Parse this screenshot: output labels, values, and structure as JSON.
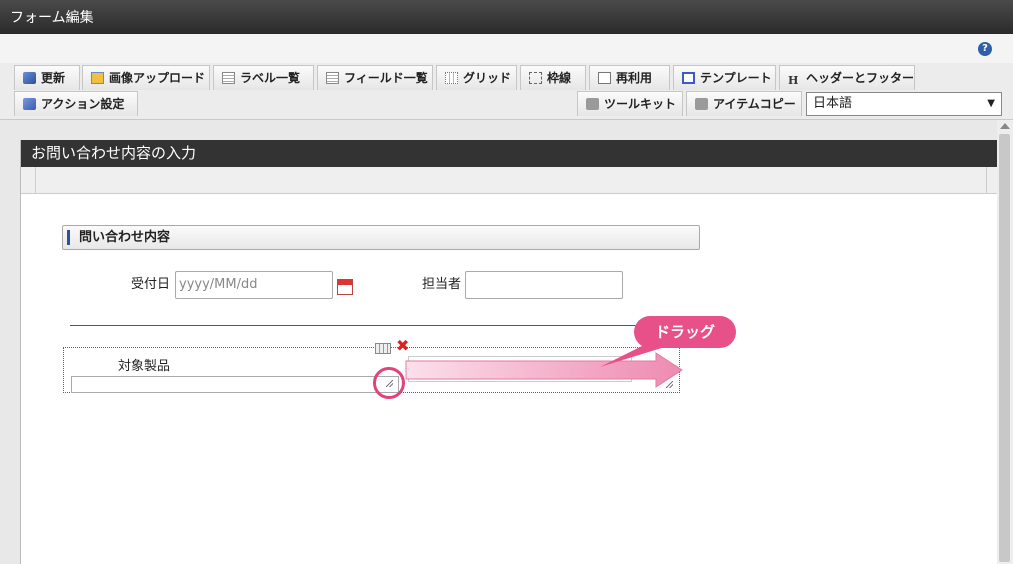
{
  "window": {
    "title": "フォーム編集"
  },
  "help": {
    "icon": "help-icon",
    "glyph": "?"
  },
  "toolbar": {
    "row1": [
      {
        "id": "refresh",
        "label": "更新",
        "icon": "refresh-icon"
      },
      {
        "id": "image-upload",
        "label": "画像アップロード",
        "icon": "image-icon"
      },
      {
        "id": "label-list",
        "label": "ラベル一覧",
        "icon": "list-icon"
      },
      {
        "id": "field-list",
        "label": "フィールド一覧",
        "icon": "list-icon"
      },
      {
        "id": "grid",
        "label": "グリッド",
        "icon": "grid-icon"
      },
      {
        "id": "frame",
        "label": "枠線",
        "icon": "frame-icon"
      },
      {
        "id": "reuse",
        "label": "再利用",
        "icon": "document-icon"
      },
      {
        "id": "template",
        "label": "テンプレート",
        "icon": "template-icon"
      },
      {
        "id": "header-footer",
        "label": "ヘッダーとフッター",
        "icon": "h-icon",
        "glyph": "H"
      }
    ],
    "row2_left": [
      {
        "id": "action-settings",
        "label": "アクション設定",
        "icon": "action-icon"
      }
    ],
    "row2_right": [
      {
        "id": "toolkit",
        "label": "ツールキット",
        "icon": "toolbox-icon"
      },
      {
        "id": "item-copy",
        "label": "アイテムコピー",
        "icon": "toolbox-icon"
      }
    ],
    "language": {
      "selected": "日本語",
      "arrow": "▼"
    }
  },
  "panel": {
    "title": "お問い合わせ内容の入力",
    "section_title": "問い合わせ内容",
    "fields": {
      "received_date": {
        "label": "受付日",
        "placeholder": "yyyy/MM/dd",
        "icon": "calendar-icon"
      },
      "assignee": {
        "label": "担当者",
        "value": ""
      },
      "target_product": {
        "label": "対象製品",
        "value": ""
      }
    },
    "selection_tools": {
      "grid_icon": "grid-icon",
      "delete_icon": "close-icon",
      "delete_glyph": "✖"
    },
    "callout": {
      "text": "ドラッグ"
    }
  },
  "colors": {
    "accent": "#e0447a",
    "callout_fill": "#e8508a",
    "section_bar": "#2f4f99",
    "title_bg": "#333333"
  }
}
